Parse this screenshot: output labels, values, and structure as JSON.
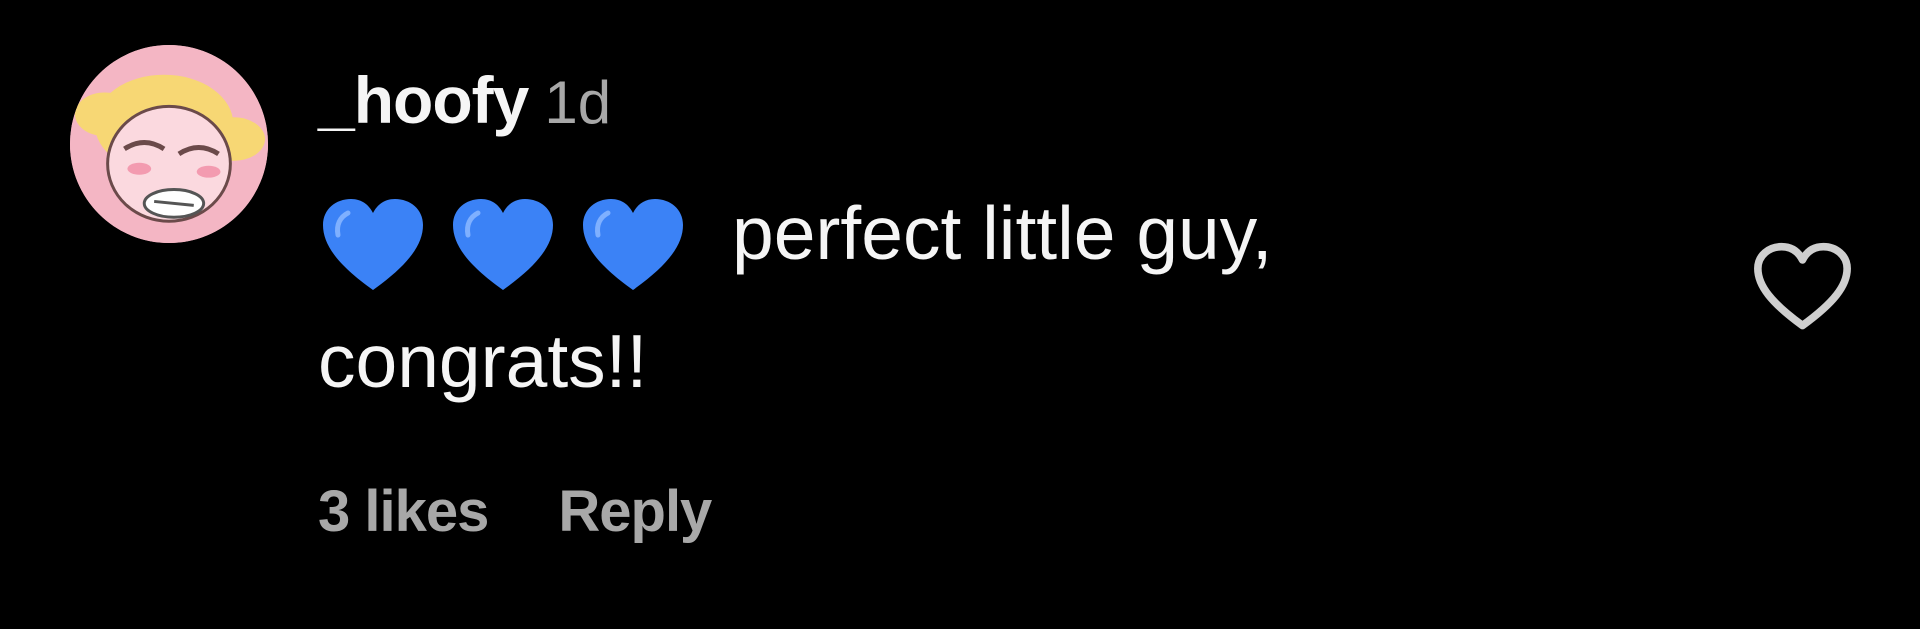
{
  "comment": {
    "avatar_icon": "cartoon-girl-avatar-icon",
    "username": "_hoofy",
    "timestamp": "1d",
    "emoji": [
      "blue-heart",
      "blue-heart",
      "blue-heart"
    ],
    "text": "perfect little guy, congrats!!",
    "likes": "3 likes",
    "reply_label": "Reply",
    "like_icon": "heart-outline-icon"
  },
  "colors": {
    "background": "#000000",
    "primary_text": "#f5f5f5",
    "secondary_text": "#a8a8a8",
    "emoji_blue": "#3b82f6",
    "avatar_bg": "#f4b6c4"
  }
}
